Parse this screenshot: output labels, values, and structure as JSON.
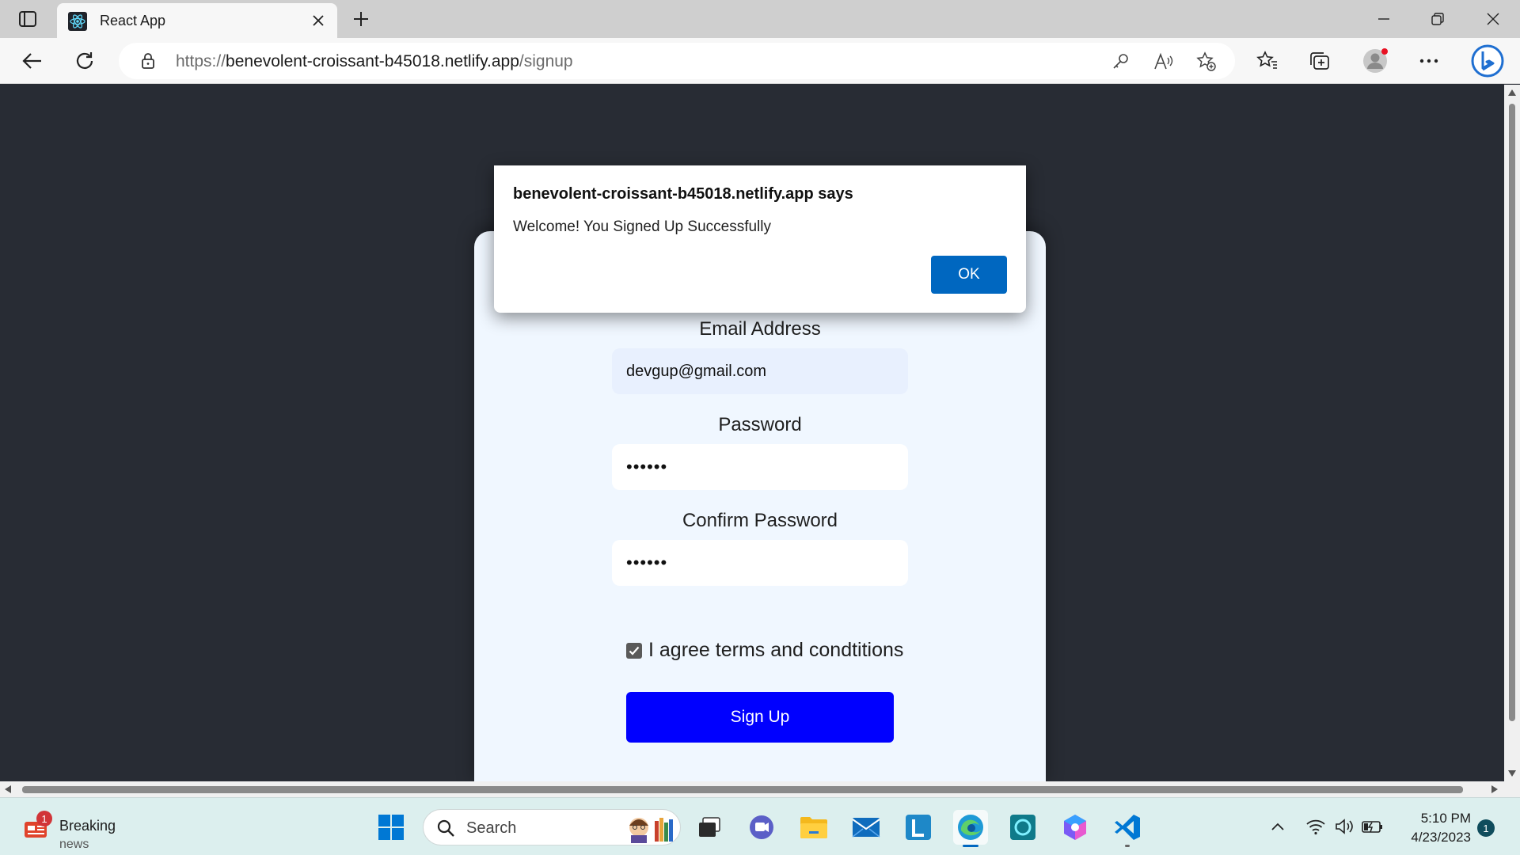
{
  "browser": {
    "tab": {
      "title": "React App"
    },
    "address": {
      "protocol": "https://",
      "domain": "benevolent-croissant-b45018.netlify.app",
      "path": "/signup"
    }
  },
  "dialog": {
    "title": "benevolent-croissant-b45018.netlify.app says",
    "message": "Welcome! You Signed Up Successfully",
    "ok_label": "OK"
  },
  "form": {
    "email_label": "Email Address",
    "email_value": "devgup@gmail.com",
    "password_label": "Password",
    "password_value": "••••••",
    "confirm_label": "Confirm Password",
    "confirm_value": "••••••",
    "agree_label": "I agree terms and condtitions",
    "agree_checked": true,
    "submit_label": "Sign Up"
  },
  "taskbar": {
    "widget": {
      "badge": "1",
      "line1": "Breaking",
      "line2": "news"
    },
    "search_placeholder": "Search",
    "time": "5:10 PM",
    "date": "4/23/2023",
    "notification_count": "1"
  },
  "colors": {
    "page_bg": "#282c34",
    "card_bg": "#f0f7ff",
    "signup_button": "#0000ff",
    "dialog_ok": "#0067c0"
  }
}
